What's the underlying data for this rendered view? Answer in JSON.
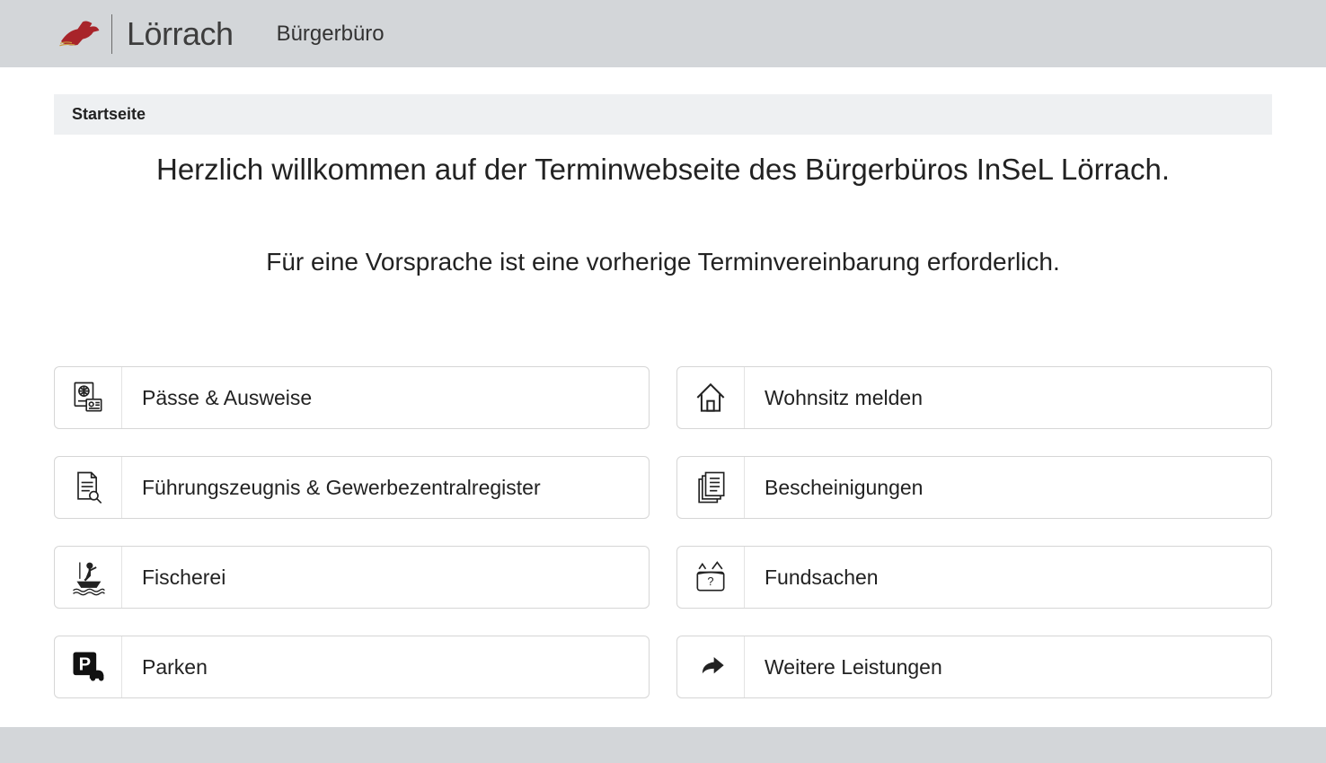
{
  "header": {
    "logo_text": "Lörrach",
    "section_title": "Bürgerbüro"
  },
  "breadcrumb": {
    "label": "Startseite"
  },
  "hero": {
    "title": "Herzlich willkommen auf der Terminwebseite des Bürgerbüros InSeL Lörrach.",
    "subtitle": "Für eine Vorsprache ist eine vorherige Terminvereinbarung erforderlich."
  },
  "services": [
    {
      "label": "Pässe & Ausweise",
      "icon": "passport"
    },
    {
      "label": "Wohnsitz melden",
      "icon": "house"
    },
    {
      "label": "Führungszeugnis & Gewerbezentralregister",
      "icon": "document-search"
    },
    {
      "label": "Bescheinigungen",
      "icon": "documents"
    },
    {
      "label": "Fischerei",
      "icon": "fishing"
    },
    {
      "label": "Fundsachen",
      "icon": "lost-found"
    },
    {
      "label": "Parken",
      "icon": "parking"
    },
    {
      "label": "Weitere Leistungen",
      "icon": "forward"
    }
  ]
}
